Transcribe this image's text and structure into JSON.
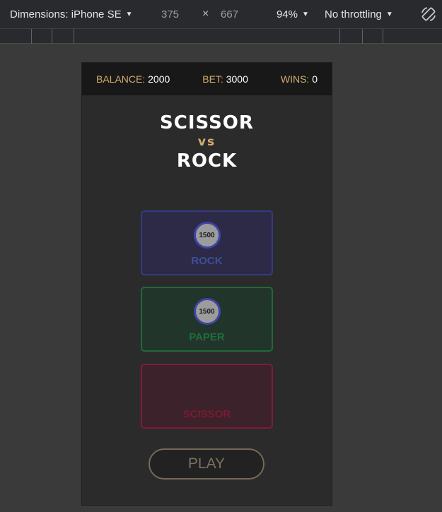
{
  "devtools": {
    "device_label": "Dimensions: iPhone SE",
    "width_value": "375",
    "times_symbol": "×",
    "height_value": "667",
    "zoom_label": "94%",
    "throttle_label": "No throttling"
  },
  "game": {
    "stats": {
      "balance_label": "BALANCE:",
      "balance_value": "2000",
      "bet_label": "BET:",
      "bet_value": "3000",
      "wins_label": "WINS:",
      "wins_value": "0"
    },
    "headline": {
      "line1": "SCISSOR",
      "vs": "vs",
      "line2": "ROCK"
    },
    "choices": [
      {
        "label": "ROCK",
        "chip": "1500",
        "color": "#3f4e99"
      },
      {
        "label": "PAPER",
        "chip": "1500",
        "color": "#1e6f3b"
      },
      {
        "label": "SCISSOR",
        "chip": "",
        "color": "#7a1a30"
      }
    ],
    "play_label": "PLAY"
  },
  "colors": {
    "accent_gold": "#d2ad6f",
    "background": "#2b2b2b",
    "topbar": "#181818"
  }
}
